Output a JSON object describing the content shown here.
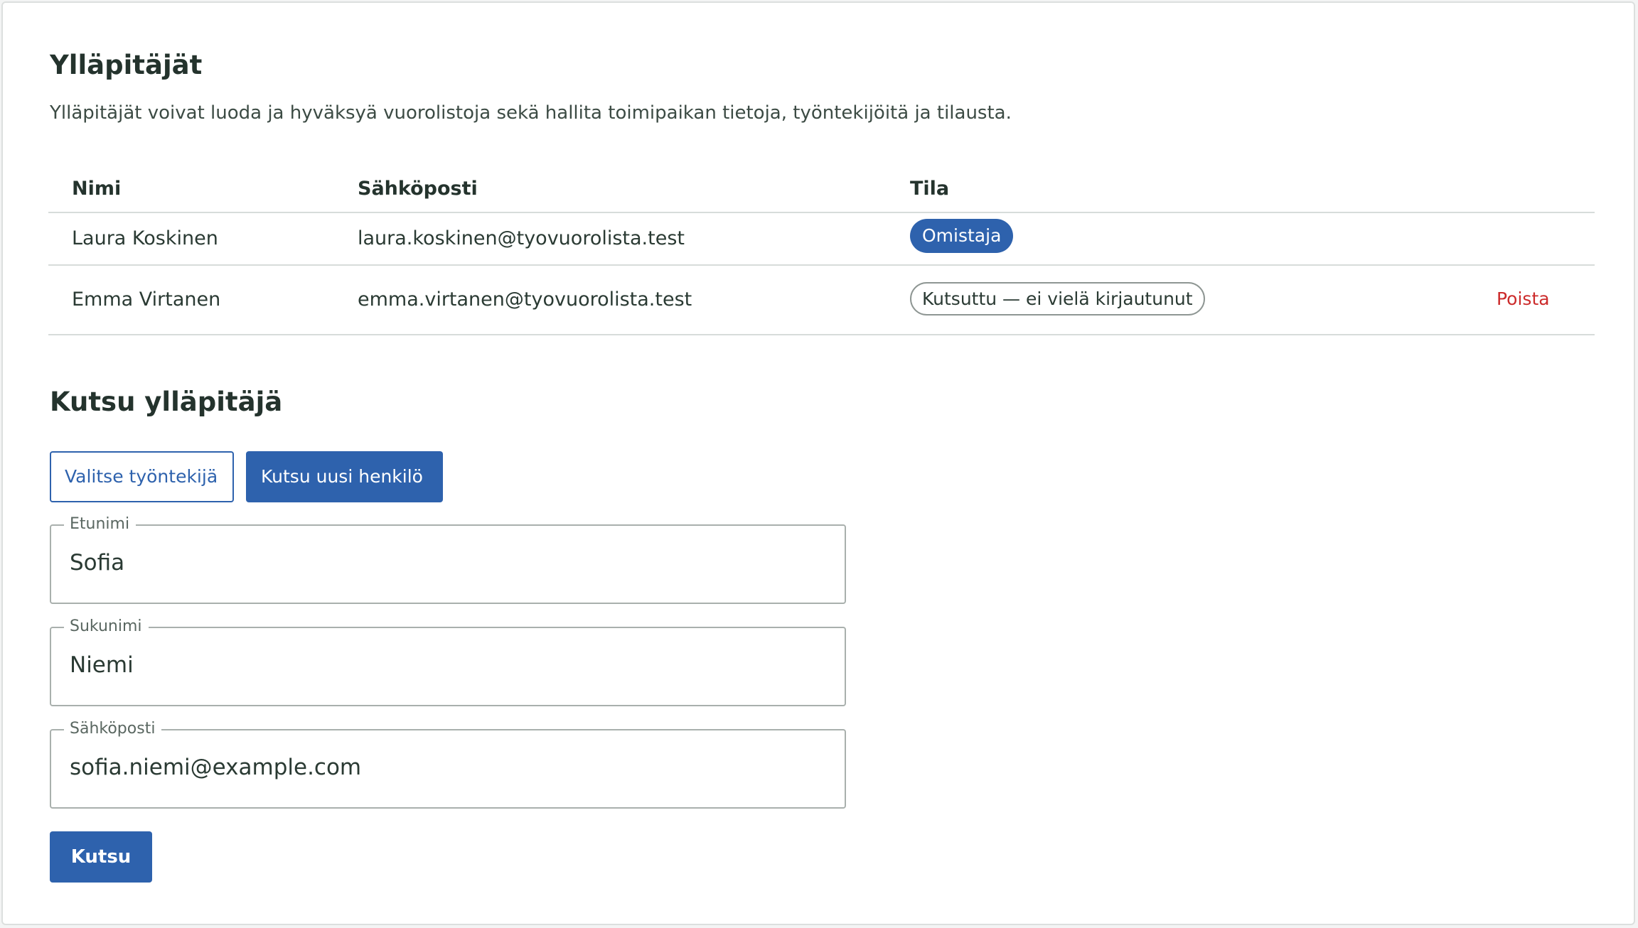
{
  "admins": {
    "title": "Ylläpitäjät",
    "description": "Ylläpitäjät voivat luoda ja hyväksyä vuorolistoja sekä hallita toimipaikan tietoja, työntekijöitä ja tilausta.",
    "columns": {
      "name": "Nimi",
      "email": "Sähköposti",
      "status": "Tila"
    },
    "rows": [
      {
        "name": "Laura Koskinen",
        "email": "laura.koskinen@tyovuorolista.test",
        "status": "Omistaja"
      },
      {
        "name": "Emma Virtanen",
        "email": "emma.virtanen@tyovuorolista.test",
        "status": "Kutsuttu — ei vielä kirjautunut",
        "action": "Poista"
      }
    ]
  },
  "invite": {
    "title": "Kutsu ylläpitäjä",
    "mode_buttons": {
      "select_employee": "Valitse työntekijä",
      "invite_new": "Kutsu uusi henkilö"
    },
    "fields": {
      "first_name": {
        "label": "Etunimi",
        "value": "Sofia"
      },
      "last_name": {
        "label": "Sukunimi",
        "value": "Niemi"
      },
      "email": {
        "label": "Sähköposti",
        "value": "sofia.niemi@example.com"
      }
    },
    "submit_label": "Kutsu"
  },
  "colors": {
    "primary": "#2e62ad",
    "danger": "#cc2b2b",
    "text": "#2a3a33",
    "border": "#d7dcda"
  }
}
